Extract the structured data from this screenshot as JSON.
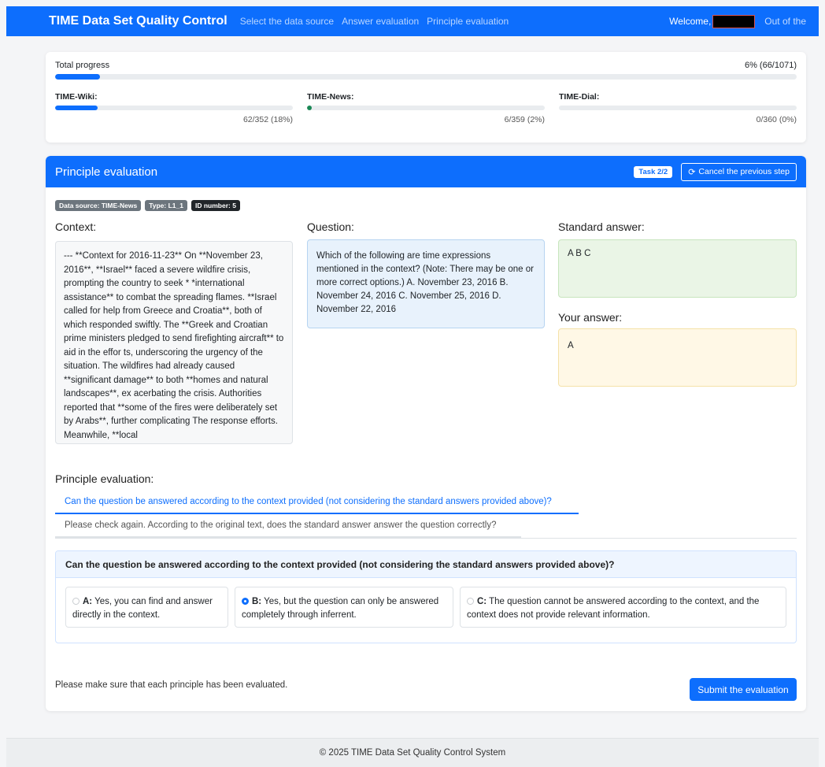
{
  "nav": {
    "brand": "TIME Data Set Quality Control",
    "links": [
      "Select the data source",
      "Answer evaluation",
      "Principle evaluation"
    ],
    "welcome": "Welcome,",
    "logout": "Out of the"
  },
  "progress": {
    "total_label": "Total progress",
    "total_text": "6% (66/1071)",
    "total_fraction": 0.06,
    "subsets": [
      {
        "name": "TIME-Wiki:",
        "count": "62/352 (18%)",
        "fraction": 0.18
      },
      {
        "name": "TIME-News:",
        "count": "6/359 (2%)",
        "fraction": 0.02
      },
      {
        "name": "TIME-Dial:",
        "count": "0/360 (0%)",
        "fraction": 0.0
      }
    ]
  },
  "eval": {
    "title": "Principle evaluation",
    "task": "Task 2/2",
    "cancel": "Cancel the previous step",
    "tags": {
      "source": "Data source: TIME-News",
      "type": "Type: L1_1",
      "id": "ID number: 5"
    },
    "context_label": "Context:",
    "question_label": "Question:",
    "standard_label": "Standard answer:",
    "your_label": "Your answer:",
    "context": "--- **Context for 2016-11-23** On **November 23, 2016**, **Israel** faced a severe wildfire crisis, prompting the country to seek * *international assistance** to combat the spreading flames. **Israel called for help from Greece and Croatia**, both of which responded swiftly. The **Greek and Croatian prime ministers pledged to send firefighting aircraft** to aid in the effor ts, underscoring the urgency of the situation. The wildfires had already caused **significant damage** to both **homes and natural landscapes**, ex acerbating the crisis. Authorities reported that **some of the fires were deliberately set by Arabs**, further complicating The response efforts. Meanwhile, **local",
    "question": "Which of the following are time expressions mentioned in the context? (Note: There may be one or more correct options.) A. November 23, 2016 B. November 24, 2016 C. November 25, 2016 D. November 22, 2016",
    "standard_answer": "A B C",
    "your_answer": "A",
    "principle_label": "Principle evaluation:",
    "tabs": [
      "Can the question be answered according to the context provided (not considering the standard answers provided above)?",
      "Please check again. According to the original text, does the standard answer answer the question correctly?"
    ],
    "panel_question": "Can the question be answered according to the context provided (not considering the standard answers provided above)?",
    "options": [
      {
        "letter": "A:",
        "text": "Yes, you can find and answer directly in the context."
      },
      {
        "letter": "B:",
        "text": "Yes, but the question can only be answered completely through inferrent."
      },
      {
        "letter": "C:",
        "text": "The question cannot be answered according to the context, and the context does not provide relevant information."
      }
    ],
    "selected_option": "B",
    "note": "Please make sure that each principle has been evaluated.",
    "submit": "Submit the evaluation"
  },
  "footer": "© 2025 TIME Data Set Quality Control System"
}
